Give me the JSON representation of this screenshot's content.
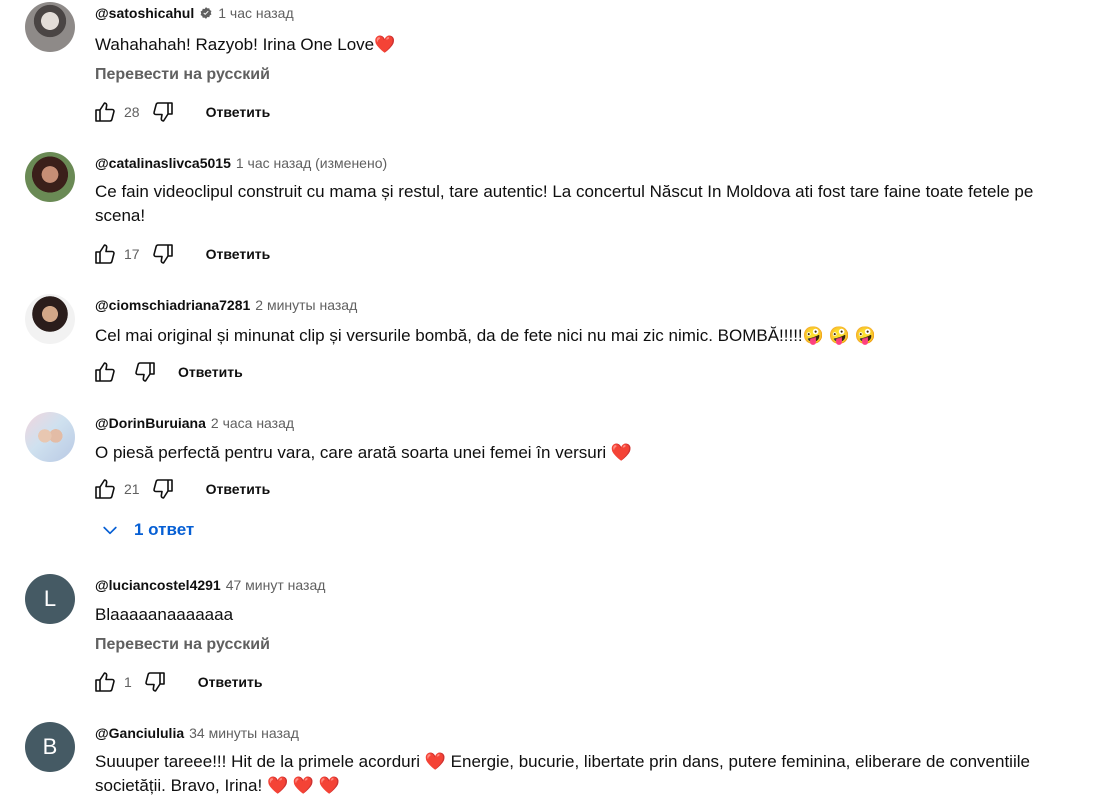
{
  "comments": [
    {
      "author": "@satoshicahul",
      "verified": true,
      "time": "1 час назад",
      "text": "Wahahahah! Razyob! Irina One Love❤️",
      "translate": "Перевести на русский",
      "likes": "28",
      "reply_label": "Ответить"
    },
    {
      "author": "@catalinaslivca5015",
      "time": "1 час назад (изменено)",
      "text": "Ce fain videoclipul construit cu mama și restul, tare autentic! La concertul Născut In Moldova ati fost tare faine toate fetele pe scena!",
      "likes": "17",
      "reply_label": "Ответить"
    },
    {
      "author": "@ciomschiadriana7281",
      "time": "2 минуты назад",
      "text": "Cel mai original și minunat clip și versurile bombă, da de fete nici nu mai zic nimic. BOMBĂ!!!!!🤪 🤪 🤪",
      "likes": "",
      "reply_label": "Ответить"
    },
    {
      "author": "@DorinBuruiana",
      "time": "2 часа назад",
      "text": "O piesă perfectă pentru vara, care arată soarta unei femei în versuri ❤️",
      "likes": "21",
      "reply_label": "Ответить",
      "replies_label": "1 ответ"
    },
    {
      "author": "@luciancostel4291",
      "avatar_letter": "L",
      "time": "47 минут назад",
      "text": "Blaaaaanaaaaaaa",
      "translate": "Перевести на русский",
      "likes": "1",
      "reply_label": "Ответить"
    },
    {
      "author": "@Ganciululia",
      "avatar_letter": "B",
      "time": "34 минуты назад",
      "text": "Suuuper tareee!!! Hit de la primele acorduri ❤️  Energie, bucurie, libertate prin dans, putere feminina, eliberare de conventiile societății. Bravo, Irina! ❤️ ❤️ ❤️"
    }
  ],
  "icons": {
    "like": "thumbs-up-icon",
    "dislike": "thumbs-down-icon",
    "verified": "verified-badge-icon",
    "expand": "chevron-down-icon"
  },
  "colors": {
    "link_blue": "#065fd4",
    "meta_gray": "#606060",
    "avatar_letter_bg": "#455a64"
  }
}
